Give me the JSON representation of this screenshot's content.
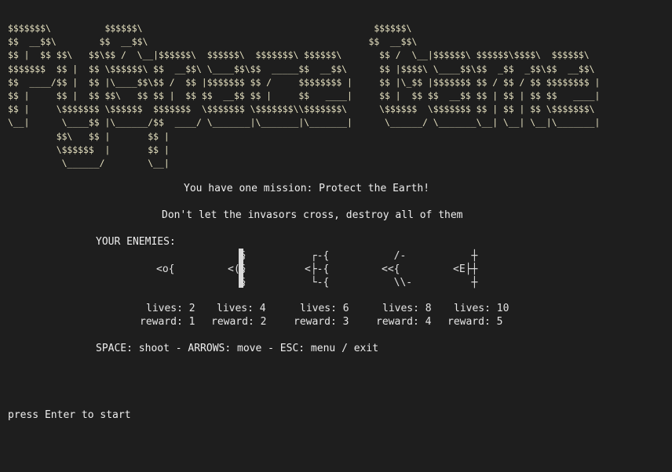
{
  "banner_ascii": "$$$$$$$\\          $$$$$$\\                                           $$$$$$\\\n$$  __$$\\        $$  __$$\\                                         $$  __$$\\\n$$ |  $$ $$\\   $$\\$$ /  \\__|$$$$$$\\  $$$$$$\\  $$$$$$$\\ $$$$$$\\       $$ /  \\__|$$$$$$\\ $$$$$$\\$$$$\\  $$$$$$\\\n$$$$$$$  $$ |  $$ \\$$$$$$\\ $$  __$$\\ \\____$$\\$$  _____$$  __$$\\      $$ |$$$$\\ \\____$$\\$$  _$$  _$$\\$$  __$$\\\n$$  ____/$$ |  $$ |\\____$$\\$$ /  $$ |$$$$$$$ $$ /     $$$$$$$$ |     $$ |\\_$$ |$$$$$$$ $$ / $$ / $$ $$$$$$$$ |\n$$ |     $$ |  $$ $$\\   $$ $$ |  $$ $$  __$$ $$ |     $$   ____|     $$ |  $$ $$  __$$ $$ | $$ | $$ $$   ____|\n$$ |     \\$$$$$$$ \\$$$$$$  $$$$$$$  \\$$$$$$$ \\$$$$$$$\\\\$$$$$$$\\      \\$$$$$$  \\$$$$$$$ $$ | $$ | $$ \\$$$$$$$\\\n\\__|      \\____$$ |\\______/$$  ____/ \\_______|\\_______|\\_______|      \\______/ \\_______\\__| \\__| \\__|\\_______|\n         $$\\   $$ |       $$ |\n         \\$$$$$$  |       $$ |\n          \\______/        \\__|",
  "intro": {
    "mission": "You have one mission: Protect the Earth!",
    "instruction": "Don't let the invasors cross, destroy all of them"
  },
  "enemies_heading": "YOUR ENEMIES:",
  "enemies": [
    {
      "sprite": "\n<o{\n",
      "lives": "lives: 2",
      "reward": "reward: 1"
    },
    {
      "sprite": "  §\n<(§\n  §",
      "lives": "lives: 4",
      "reward": "reward: 2"
    },
    {
      "sprite": " ┌-{\n<├-{\n └-{",
      "lives": "lives: 6",
      "reward": "reward: 3"
    },
    {
      "sprite": "  /-\n<<{\n  \\\\-",
      "lives": "lives: 8",
      "reward": "reward: 4"
    },
    {
      "sprite": "   ┼\n<E├┼\n   ┼",
      "lives": "lives: 10",
      "reward": "reward: 5"
    }
  ],
  "controls": "SPACE: shoot - ARROWS: move - ESC: menu / exit",
  "prompt": "press Enter to start",
  "colors": {
    "background": "#1e1e1e",
    "banner_text": "#e8e3c2",
    "text": "#eeeeee"
  }
}
